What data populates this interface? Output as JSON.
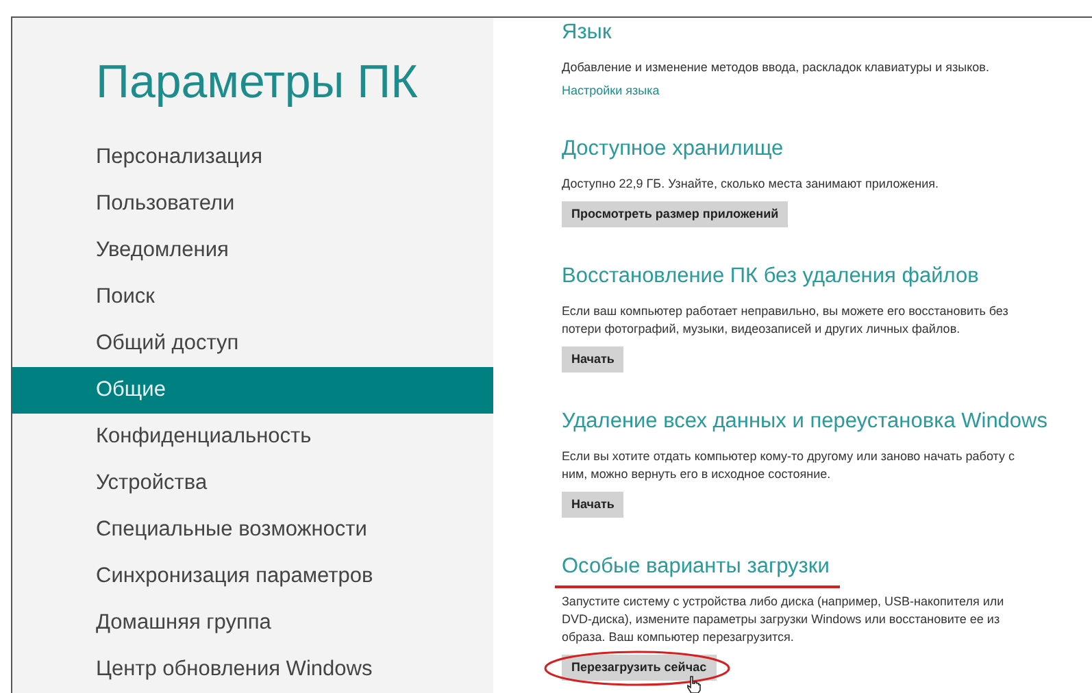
{
  "window": {
    "title": "Параметры ПК"
  },
  "sidebar": {
    "items": [
      {
        "label": "Персонализация",
        "selected": false
      },
      {
        "label": "Пользователи",
        "selected": false
      },
      {
        "label": "Уведомления",
        "selected": false
      },
      {
        "label": "Поиск",
        "selected": false
      },
      {
        "label": "Общий доступ",
        "selected": false
      },
      {
        "label": "Общие",
        "selected": true
      },
      {
        "label": "Конфиденциальность",
        "selected": false
      },
      {
        "label": "Устройства",
        "selected": false
      },
      {
        "label": "Специальные возможности",
        "selected": false
      },
      {
        "label": "Синхронизация параметров",
        "selected": false
      },
      {
        "label": "Домашняя группа",
        "selected": false
      },
      {
        "label": "Центр обновления Windows",
        "selected": false
      }
    ]
  },
  "sections": [
    {
      "heading": "Язык",
      "description": "Добавление и изменение методов ввода, раскладок клавиатуры и языков.",
      "action": {
        "kind": "link",
        "label": "Настройки языка"
      },
      "highlighted": false
    },
    {
      "heading": "Доступное хранилище",
      "description": "Доступно 22,9 ГБ. Узнайте, сколько места занимают приложения.",
      "action": {
        "kind": "button",
        "label": "Просмотреть размер приложений"
      },
      "highlighted": false
    },
    {
      "heading": "Восстановление ПК без удаления файлов",
      "description": "Если ваш компьютер работает неправильно, вы можете его восстановить без потери фотографий, музыки, видеозаписей и других личных файлов.",
      "action": {
        "kind": "button",
        "label": "Начать"
      },
      "highlighted": false
    },
    {
      "heading": "Удаление всех данных и переустановка Windows",
      "description": "Если вы хотите отдать компьютер кому-то другому или заново начать работу с ним, можно вернуть его в исходное состояние.",
      "action": {
        "kind": "button",
        "label": "Начать"
      },
      "highlighted": false
    },
    {
      "heading": "Особые варианты загрузки",
      "description": "Запустите систему с устройства либо диска (например, USB-накопителя или DVD-диска), измените параметры загрузки Windows или восстановите ее из образа. Ваш компьютер перезагрузится.",
      "action": {
        "kind": "button",
        "label": "Перезагрузить сейчас"
      },
      "highlighted": true
    }
  ]
}
